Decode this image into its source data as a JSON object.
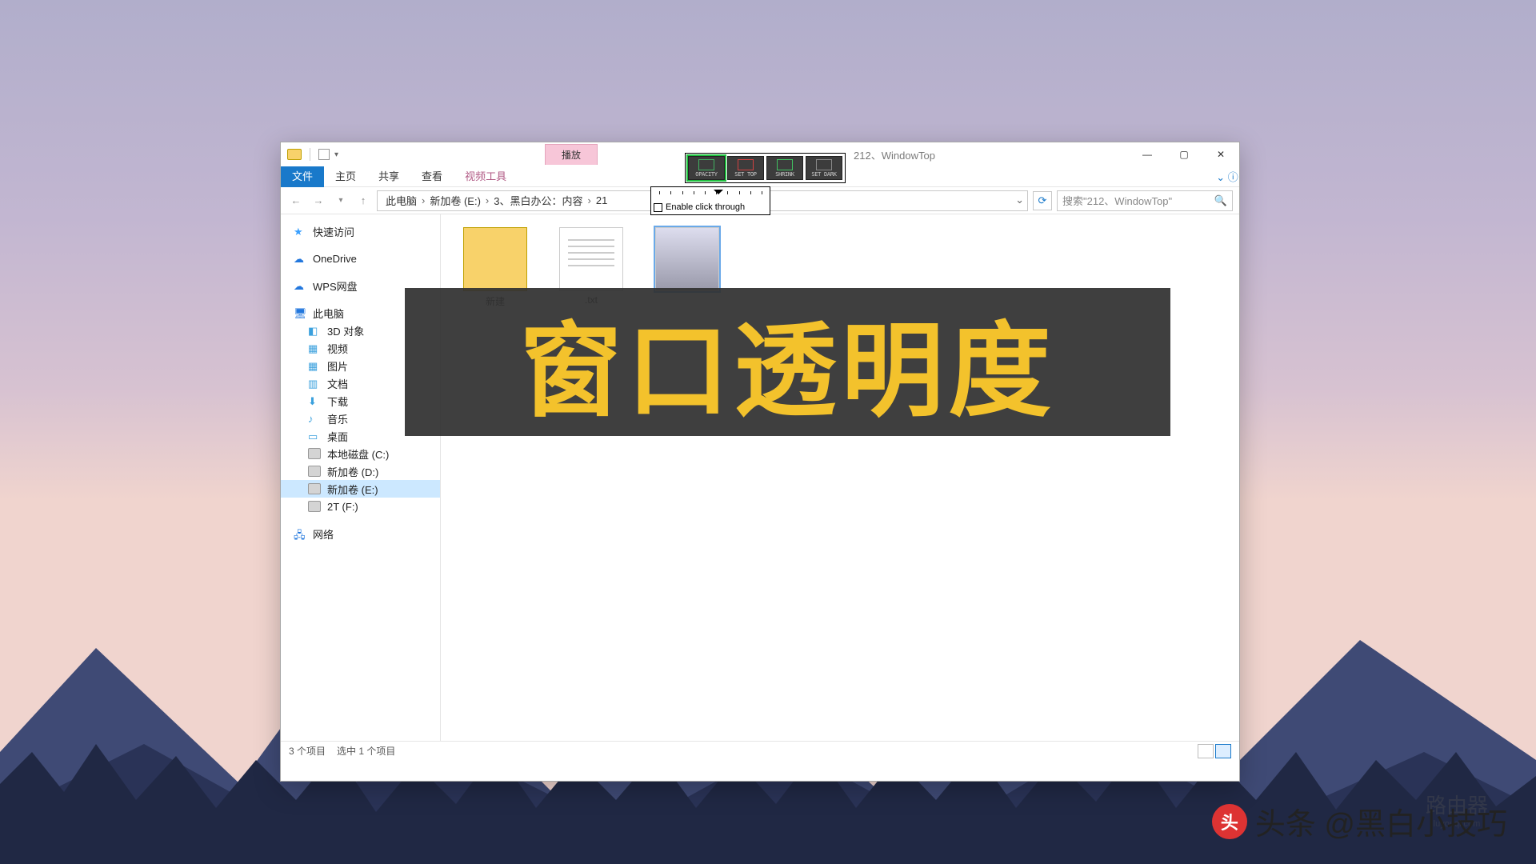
{
  "desktop": {
    "gradient_top": "#b1aecb",
    "gradient_bottom": "#f0d4ce"
  },
  "explorer": {
    "title": "212、WindowTop",
    "tab_play": "播放",
    "ribbon": {
      "file": "文件",
      "home": "主页",
      "share": "共享",
      "view": "查看",
      "video_tools": "视频工具"
    },
    "breadcrumb": {
      "pc": "此电脑",
      "drive": "新加卷 (E:)",
      "folder1": "3、黑白办公：内容",
      "folder2": "21"
    },
    "search_placeholder": "搜索\"212、WindowTop\"",
    "sidebar": {
      "quick_access": "快速访问",
      "onedrive": "OneDrive",
      "wps": "WPS网盘",
      "this_pc": "此电脑",
      "objects_3d": "3D 对象",
      "videos": "视频",
      "pictures": "图片",
      "documents": "文档",
      "downloads": "下载",
      "music": "音乐",
      "desktop": "桌面",
      "disk_c": "本地磁盘 (C:)",
      "disk_d": "新加卷 (D:)",
      "disk_e": "新加卷 (E:)",
      "disk_f": "2T (F:)",
      "network": "网络"
    },
    "files": {
      "item1": "新建",
      "item2": ".txt",
      "item3": ""
    },
    "status": {
      "count": "3 个项目",
      "selected": "选中 1 个项目"
    }
  },
  "wintop": {
    "opacity": "OPACITY",
    "settop": "SET TOP",
    "shrink": "SHRINK",
    "setdark": "SET DARK",
    "click_through": "Enable click through"
  },
  "overlay": {
    "text": "窗口透明度"
  },
  "channel": {
    "prefix": "头条",
    "name": "@黑白小技巧"
  },
  "router": {
    "name": "路由器",
    "sub": "luyouqi.com"
  }
}
